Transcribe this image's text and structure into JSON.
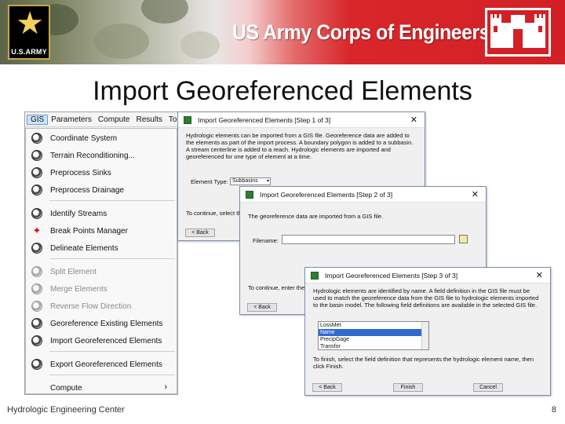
{
  "header": {
    "army_logo_text": "U.S.ARMY",
    "org_title": "US Army Corps of Engineers"
  },
  "slide": {
    "title": "Import Georeferenced Elements",
    "footer_left": "Hydrologic Engineering Center",
    "page_number": "8"
  },
  "menubar": [
    "GIS",
    "Parameters",
    "Compute",
    "Results",
    "To"
  ],
  "gis_menu": [
    {
      "label": "Coordinate System",
      "icon": "globe-icon",
      "enabled": true
    },
    {
      "label": "Terrain Reconditioning...",
      "icon": "globe-icon",
      "enabled": true
    },
    {
      "label": "Preprocess Sinks",
      "icon": "globe-icon",
      "enabled": true
    },
    {
      "label": "Preprocess Drainage",
      "icon": "globe-icon",
      "enabled": true
    },
    {
      "label": "Identify Streams",
      "icon": "globe-icon",
      "enabled": true
    },
    {
      "label": "Break Points Manager",
      "icon": "crosshair-icon",
      "enabled": true
    },
    {
      "label": "Delineate Elements",
      "icon": "globe-icon",
      "enabled": true
    },
    {
      "label": "Split Element",
      "icon": "globe-icon",
      "enabled": false
    },
    {
      "label": "Merge Elements",
      "icon": "globe-icon",
      "enabled": false
    },
    {
      "label": "Reverse Flow Direction",
      "icon": "globe-icon",
      "enabled": false
    },
    {
      "label": "Georeference Existing Elements",
      "icon": "globe-icon",
      "enabled": true
    },
    {
      "label": "Import Georeferenced Elements",
      "icon": "globe-icon",
      "enabled": true
    },
    {
      "label": "Export Georeferenced Elements",
      "icon": "globe-icon",
      "enabled": true
    },
    {
      "label": "Compute",
      "icon": "",
      "enabled": true
    }
  ],
  "dialog1": {
    "title": "Import Georeferenced Elements [Step 1 of 3]",
    "description": "Hydrologic elements can be imported from a GIS file. Georeference data are added to the elements as part of the import process. A boundary polygon is added to a subbasin. A stream centerline is added to a reach. Hydrologic elements are imported and georeferenced for one type of element at a time.",
    "element_type_label": "Element Type:",
    "element_type_value": "Subbasins",
    "continue_text": "To continue, select th",
    "back_label": "< Back"
  },
  "dialog2": {
    "title": "Import Georeferenced Elements [Step 2 of 3]",
    "description": "The georeference data are imported from a GIS file.",
    "filename_label": "Filename:",
    "filename_value": "",
    "continue_text": "To continue, enter the",
    "back_label": "< Back"
  },
  "dialog3": {
    "title": "Import Georeferenced Elements [Step 3 of 3]",
    "description": "Hydrologic elements are identified by name. A field definition in the GIS file must be used to match the georeference data from the GIS file to hydrologic elements imported to the basin model. The following field definitions are available in the selected GIS file.",
    "fields": [
      "LossMet",
      "Name",
      "PrecipGage",
      "Transfor"
    ],
    "selected_field": "Name",
    "finish_text": "To finish, select the field definition that represents the hydrologic element name, then click Finish.",
    "back_label": "< Back",
    "finish_label": "Finish",
    "cancel_label": "Cancel"
  }
}
